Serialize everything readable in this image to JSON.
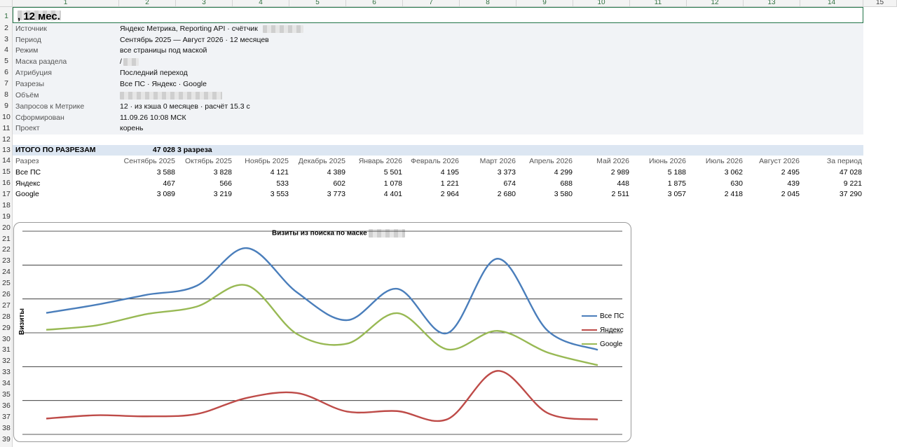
{
  "title": {
    "prefix": "Счётчик",
    "middle": ", маска /",
    "suffix": ", 12 мес."
  },
  "columns": [
    "1",
    "2",
    "3",
    "4",
    "5",
    "6",
    "7",
    "8",
    "9",
    "10",
    "11",
    "12",
    "13",
    "14",
    "15"
  ],
  "info": [
    {
      "label": "Источник",
      "value": "Яндекс Метрика, Reporting API · счётчик"
    },
    {
      "label": "Период",
      "value": "Сентябрь 2025 — Август 2026 · 12 месяцев"
    },
    {
      "label": "Режим",
      "value": "все страницы под маской"
    },
    {
      "label": "Маска раздела",
      "value": "/"
    },
    {
      "label": "Атрибуция",
      "value": "Последний переход"
    },
    {
      "label": "Разрезы",
      "value": "Все ПС · Яндекс · Google"
    },
    {
      "label": "Объём",
      "value": ""
    },
    {
      "label": "Запросов к Метрике",
      "value": "12 · из кэша 0 месяцев · расчёт 15.3 с"
    },
    {
      "label": "Сформирован",
      "value": "11.09.26 10:08 МСК"
    },
    {
      "label": "Проект",
      "value": "корень"
    }
  ],
  "totals": {
    "label": "ИТОГО ПО РАЗРЕЗАМ",
    "value": "47 028",
    "note": "3 разреза"
  },
  "table": {
    "header_label": "Разрез",
    "months": [
      "Сентябрь 2025",
      "Октябрь 2025",
      "Ноябрь 2025",
      "Декабрь 2025",
      "Январь 2026",
      "Февраль 2026",
      "Март 2026",
      "Апрель 2026",
      "Май 2026",
      "Июнь 2026",
      "Июль 2026",
      "Август 2026",
      "За период"
    ],
    "rows": [
      {
        "name": "Все ПС",
        "values": [
          "3 588",
          "3 828",
          "4 121",
          "4 389",
          "5 501",
          "4 195",
          "3 373",
          "4 299",
          "2 989",
          "5 188",
          "3 062",
          "2 495",
          "47 028"
        ]
      },
      {
        "name": "Яндекс",
        "values": [
          "467",
          "566",
          "533",
          "602",
          "1 078",
          "1 221",
          "674",
          "688",
          "448",
          "1 875",
          "630",
          "439",
          "9 221"
        ]
      },
      {
        "name": "Google",
        "values": [
          "3 089",
          "3 219",
          "3 553",
          "3 773",
          "4 401",
          "2 964",
          "2 680",
          "3 580",
          "2 511",
          "3 057",
          "2 418",
          "2 045",
          "37 290"
        ]
      }
    ]
  },
  "chart_data": {
    "type": "line",
    "title": "Визиты из поиска по маске",
    "ylabel": "Визиты",
    "categories": [
      "Сентябрь 2025",
      "Октябрь 2025",
      "Ноябрь 2025",
      "Декабрь 2025",
      "Январь 2026",
      "Февраль 2026",
      "Март 2026",
      "Апрель 2026",
      "Май 2026",
      "Июнь 2026",
      "Июль 2026",
      "Август 2026"
    ],
    "series": [
      {
        "name": "Все ПС",
        "color": "#4a7ebb",
        "values": [
          3588,
          3828,
          4121,
          4389,
          5501,
          4195,
          3373,
          4299,
          2989,
          5188,
          3062,
          2495
        ]
      },
      {
        "name": "Яндекс",
        "color": "#be4b48",
        "values": [
          467,
          566,
          533,
          602,
          1078,
          1221,
          674,
          688,
          448,
          1875,
          630,
          439
        ]
      },
      {
        "name": "Google",
        "color": "#98b954",
        "values": [
          3089,
          3219,
          3553,
          3773,
          4401,
          2964,
          2680,
          3580,
          2511,
          3057,
          2418,
          2045
        ]
      }
    ],
    "ylim": [
      0,
      6000
    ],
    "grid": true,
    "legend": "right"
  }
}
